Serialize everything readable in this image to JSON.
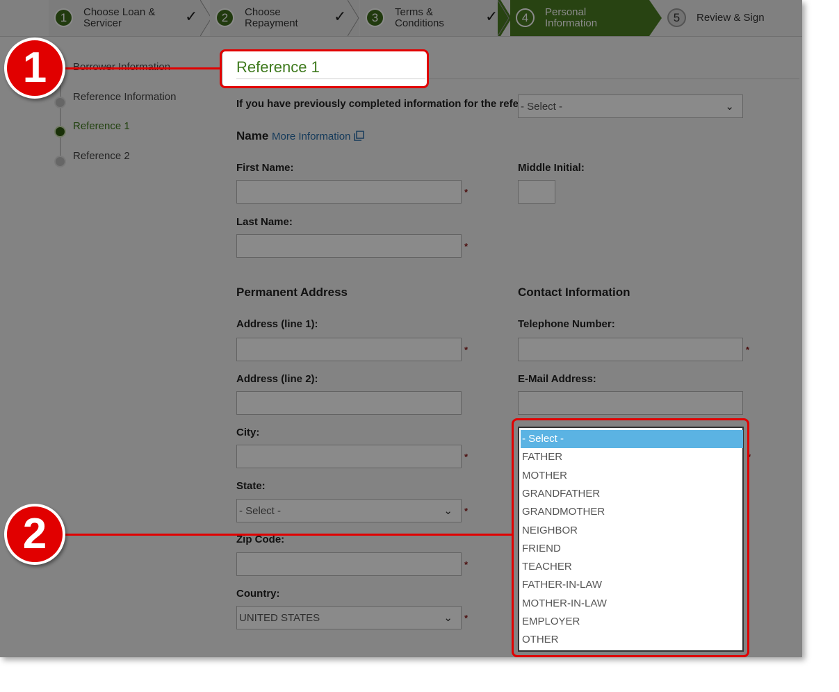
{
  "steps": [
    {
      "num": "1",
      "label_l1": "Choose Loan &",
      "label_l2": "Servicer",
      "check": "✓"
    },
    {
      "num": "2",
      "label_l1": "Choose",
      "label_l2": "Repayment",
      "check": "✓"
    },
    {
      "num": "3",
      "label_l1": "Terms &",
      "label_l2": "Conditions",
      "check": "✓"
    },
    {
      "num": "4",
      "label_l1": "Personal",
      "label_l2": "Information"
    },
    {
      "num": "5",
      "label": "Review & Sign"
    }
  ],
  "sidebar": {
    "items": [
      {
        "label": "Borrower Information"
      },
      {
        "label": "Reference Information"
      },
      {
        "label": "Reference 1"
      },
      {
        "label": "Reference 2"
      }
    ]
  },
  "main": {
    "title": "Reference 1",
    "prev_label": "If you have previously completed information for the reference:",
    "prev_select": "- Select -",
    "name_heading": "Name",
    "more_info": "More Information",
    "first_name_label": "First Name:",
    "middle_initial_label": "Middle Initial:",
    "last_name_label": "Last Name:",
    "perm_address_heading": "Permanent Address",
    "contact_heading": "Contact Information",
    "address1_label": "Address (line 1):",
    "address2_label": "Address (line 2):",
    "city_label": "City:",
    "state_label": "State:",
    "state_select": "- Select -",
    "zip_label": "Zip Code:",
    "country_label": "Country:",
    "country_select": "UNITED STATES",
    "telephone_label": "Telephone Number:",
    "email_label": "E-Mail Address:",
    "required_mark": "*"
  },
  "relationship_dropdown": {
    "options": [
      "- Select -",
      "FATHER",
      "MOTHER",
      "GRANDFATHER",
      "GRANDMOTHER",
      "NEIGHBOR",
      "FRIEND",
      "TEACHER",
      "FATHER-IN-LAW",
      "MOTHER-IN-LAW",
      "EMPLOYER",
      "OTHER"
    ],
    "selected_index": 0
  },
  "callouts": {
    "one": "1",
    "two": "2"
  },
  "colors": {
    "accent_green": "#4a7c22",
    "highlight_red": "#e10000",
    "selected_blue": "#5bb3e3"
  }
}
